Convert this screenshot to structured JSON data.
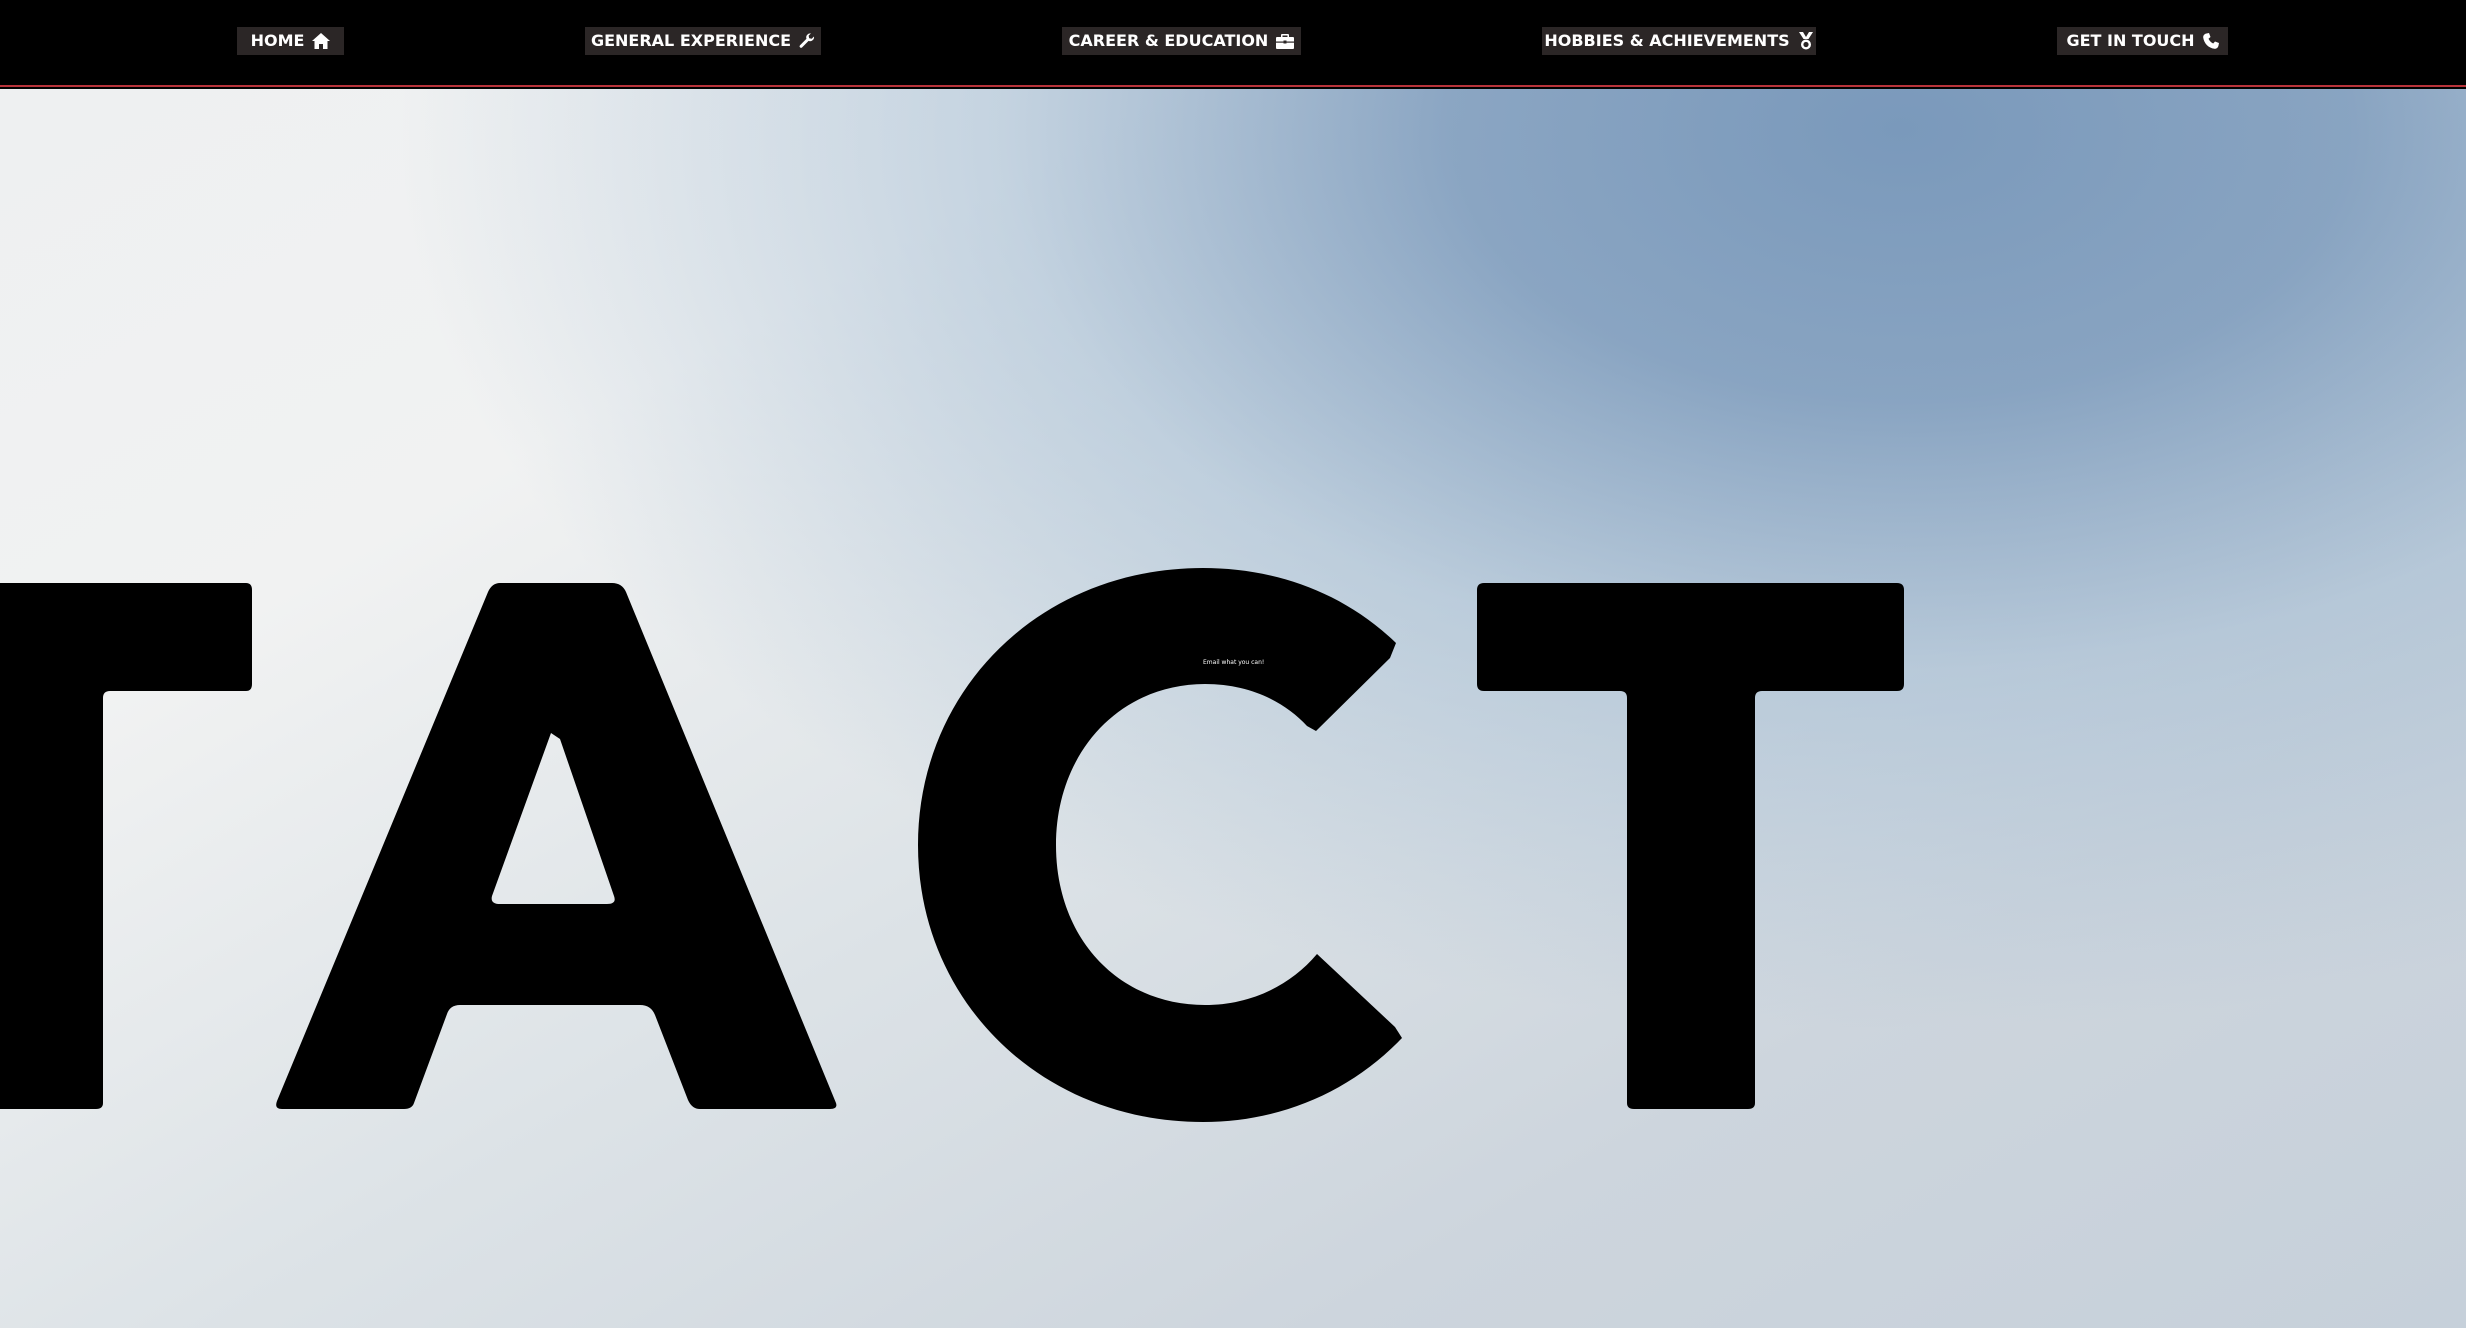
{
  "nav": {
    "home": {
      "label": "HOME",
      "icon": "home-icon"
    },
    "general": {
      "label": "GENERAL EXPERIENCE",
      "icon": "wrench-icon"
    },
    "career": {
      "label": "CAREER & EDUCATION",
      "icon": "briefcase-icon"
    },
    "hobbies": {
      "label": "HOBBIES & ACHIEVEMENTS",
      "icon": "medal-icon"
    },
    "contact": {
      "label": "GET IN TOUCH",
      "icon": "phone-icon"
    }
  },
  "hero": {
    "letters": [
      "T",
      "A",
      "C",
      "T"
    ],
    "tagline": "Email what you can!"
  },
  "colors": {
    "navbar_bg": "#000000",
    "nav_button_bg": "#2b2626",
    "nav_border": "#b8333a",
    "hero_text": "#000000",
    "hero_sky": "#7a99bb"
  }
}
